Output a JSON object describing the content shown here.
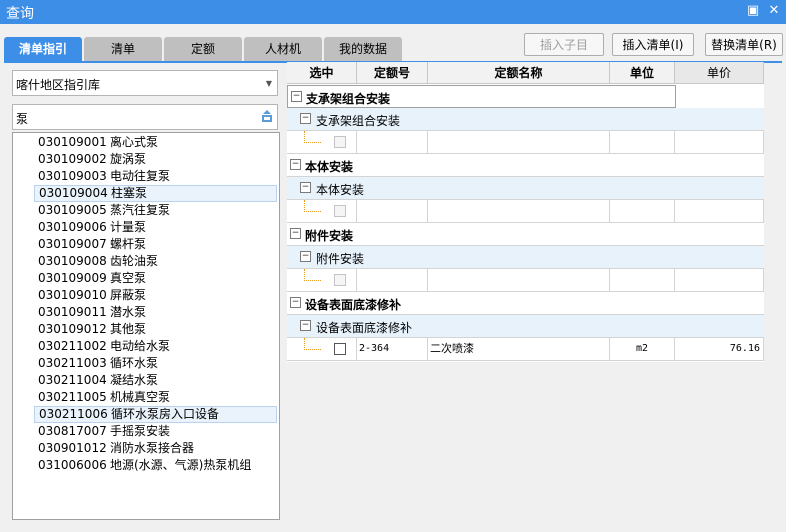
{
  "window": {
    "title": "查询",
    "restore_icon": "restore-icon",
    "close_icon": "close-icon"
  },
  "tabs": [
    {
      "label": "清单指引",
      "active": true
    },
    {
      "label": "清单",
      "active": false
    },
    {
      "label": "定额",
      "active": false
    },
    {
      "label": "人材机",
      "active": false
    },
    {
      "label": "我的数据",
      "active": false
    }
  ],
  "toolbar": {
    "insert_child": "插入子目",
    "insert_list": "插入清单(I)",
    "replace_list": "替换清单(R)"
  },
  "library_select": {
    "value": "喀什地区指引库"
  },
  "search": {
    "value": "泵"
  },
  "list_items": [
    {
      "code": "030109001",
      "name": "离心式泵"
    },
    {
      "code": "030109002",
      "name": "旋涡泵"
    },
    {
      "code": "030109003",
      "name": "电动往复泵"
    },
    {
      "code": "030109004",
      "name": "柱塞泵"
    },
    {
      "code": "030109005",
      "name": "蒸汽往复泵"
    },
    {
      "code": "030109006",
      "name": "计量泵"
    },
    {
      "code": "030109007",
      "name": "螺杆泵"
    },
    {
      "code": "030109008",
      "name": "齿轮油泵"
    },
    {
      "code": "030109009",
      "name": "真空泵"
    },
    {
      "code": "030109010",
      "name": "屏蔽泵"
    },
    {
      "code": "030109011",
      "name": "潜水泵"
    },
    {
      "code": "030109012",
      "name": "其他泵"
    },
    {
      "code": "030211002",
      "name": "电动给水泵"
    },
    {
      "code": "030211003",
      "name": "循环水泵"
    },
    {
      "code": "030211004",
      "name": "凝结水泵"
    },
    {
      "code": "030211005",
      "name": "机械真空泵"
    },
    {
      "code": "030211006",
      "name": "循环水泵房入口设备"
    },
    {
      "code": "030817007",
      "name": "手摇泵安装"
    },
    {
      "code": "030901012",
      "name": "消防水泵接合器"
    },
    {
      "code": "031006006",
      "name": "地源(水源、气源)热泵机组"
    }
  ],
  "grid": {
    "headers": {
      "select": "选中",
      "code": "定额号",
      "name": "定额名称",
      "unit": "单位",
      "price": "单价"
    },
    "groups": [
      {
        "title": "支承架组合安装",
        "sub": "支承架组合安装",
        "item": {
          "code": "",
          "name": "",
          "unit": "",
          "price": ""
        }
      },
      {
        "title": "本体安装",
        "sub": "本体安装",
        "item": {
          "code": "",
          "name": "",
          "unit": "",
          "price": ""
        }
      },
      {
        "title": "附件安装",
        "sub": "附件安装",
        "item": {
          "code": "",
          "name": "",
          "unit": "",
          "price": ""
        }
      },
      {
        "title": "设备表面底漆修补",
        "sub": "设备表面底漆修补",
        "item": {
          "code": "2-364",
          "name": "二次喷漆",
          "unit": "m2",
          "price": "76.16"
        }
      }
    ]
  },
  "expander_symbol": "−"
}
